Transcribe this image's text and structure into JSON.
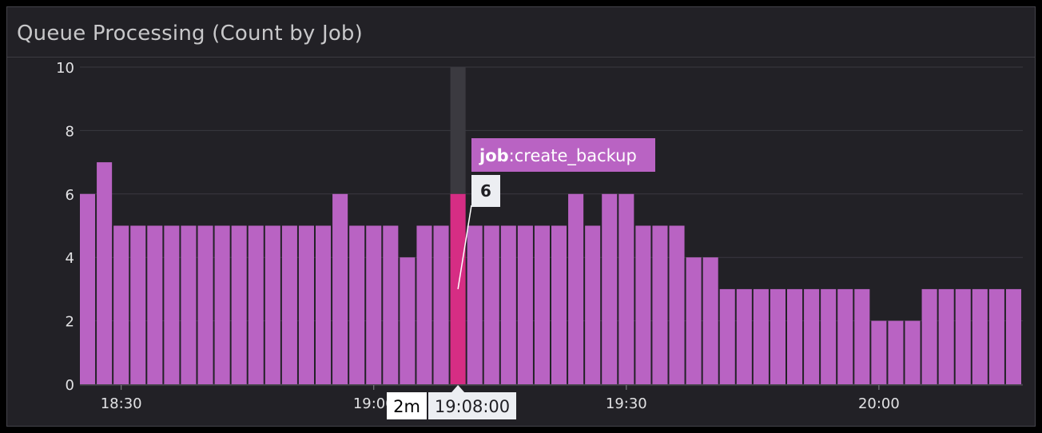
{
  "panel": {
    "title": "Queue Processing (Count by Job)"
  },
  "colors": {
    "bar": "#b963c3",
    "highlight": "#d62d84",
    "hover_band": "#3b3a40",
    "grid": "#3a3940",
    "tooltip_bg": "#b963c3",
    "value_box_bg": "#eceef2",
    "time_box_bg": "#eceef2",
    "interval_box_bg": "#ffffff"
  },
  "tooltip": {
    "key": "job",
    "value": ":create_backup",
    "count": "6",
    "interval": "2m",
    "time": "19:08:00"
  },
  "chart_data": {
    "type": "bar",
    "ylim": [
      0,
      10
    ],
    "yticks": [
      "0",
      "2",
      "4",
      "6",
      "8",
      "10"
    ],
    "xtick_labels": [
      {
        "label": "18:30",
        "index": 2
      },
      {
        "label": "19:00",
        "index": 17
      },
      {
        "label": "19:30",
        "index": 32
      },
      {
        "label": "20:00",
        "index": 47
      }
    ],
    "values": [
      6,
      7,
      5,
      5,
      5,
      5,
      5,
      5,
      5,
      5,
      5,
      5,
      5,
      5,
      5,
      6,
      5,
      5,
      5,
      4,
      5,
      5,
      6,
      5,
      5,
      5,
      5,
      5,
      5,
      6,
      5,
      6,
      6,
      5,
      5,
      5,
      4,
      4,
      3,
      3,
      3,
      3,
      3,
      3,
      3,
      3,
      3,
      2,
      2,
      2,
      3,
      3,
      3,
      3,
      3,
      3
    ],
    "highlight_index": 22,
    "grid": true
  }
}
